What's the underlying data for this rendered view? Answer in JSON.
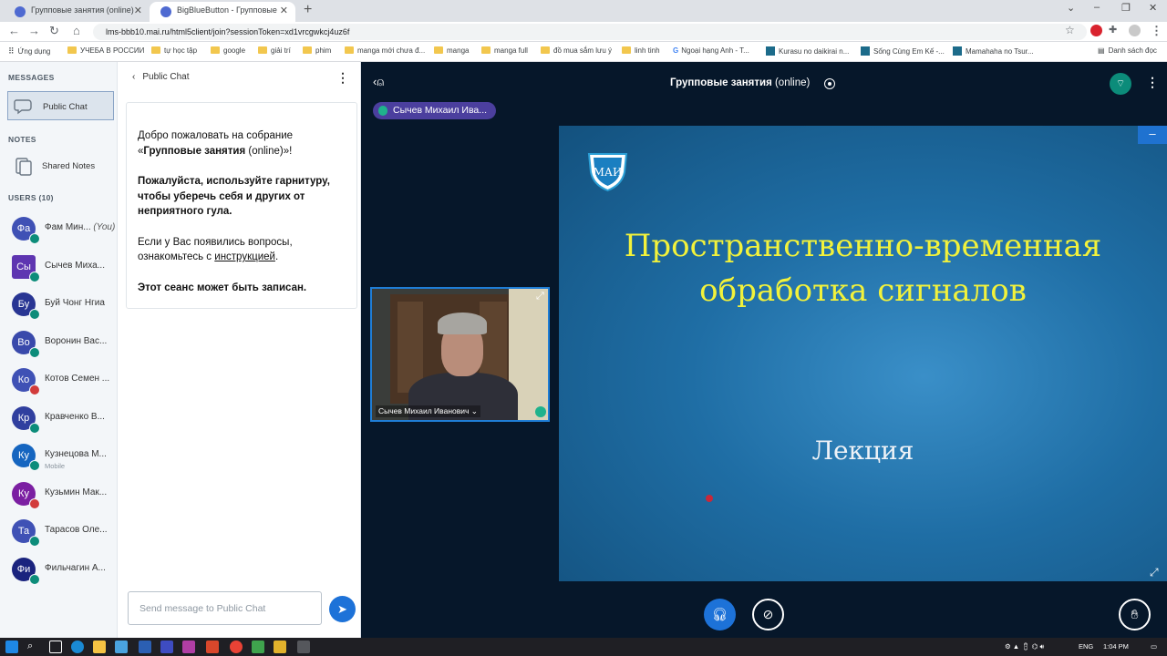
{
  "browser": {
    "tabs": [
      {
        "title": "Групповые занятия (online)",
        "active": false
      },
      {
        "title": "BigBlueButton - Групповые",
        "active": true
      }
    ],
    "url": "lms-bbb10.mai.ru/html5client/join?sessionToken=xd1vrcgwkcj4uz6f",
    "bookmarks": [
      {
        "label": "Ứng dụng",
        "kind": "apps"
      },
      {
        "label": "УЧЕБА В РОССИИ",
        "kind": "folder"
      },
      {
        "label": "tự học tập",
        "kind": "folder"
      },
      {
        "label": "google",
        "kind": "folder"
      },
      {
        "label": "giải trí",
        "kind": "folder"
      },
      {
        "label": "phim",
        "kind": "folder"
      },
      {
        "label": "manga mới chưa đ...",
        "kind": "folder"
      },
      {
        "label": "manga",
        "kind": "folder"
      },
      {
        "label": "manga full",
        "kind": "folder"
      },
      {
        "label": "đồ mua sắm lưu ý",
        "kind": "folder"
      },
      {
        "label": "linh tinh",
        "kind": "folder"
      },
      {
        "label": "Ngoại hạng Anh - T...",
        "kind": "site"
      },
      {
        "label": "Kurasu no daikirai n...",
        "kind": "site"
      },
      {
        "label": "Sống Cùng Em Kế -...",
        "kind": "site"
      },
      {
        "label": "Mamahaha no Tsur...",
        "kind": "site"
      },
      {
        "label": "Danh sách đọc",
        "kind": "reading-list"
      }
    ]
  },
  "sidebar": {
    "messages_title": "MESSAGES",
    "public_chat": "Public Chat",
    "notes_title": "NOTES",
    "shared_notes": "Shared Notes",
    "users_title": "USERS (10)",
    "users": [
      {
        "initials": "Фа",
        "name": "Фам Мин...",
        "suffix": "(You)",
        "color": "#3f51b5",
        "badge": "g",
        "square": false,
        "sub": ""
      },
      {
        "initials": "Сы",
        "name": "Сычев Миха...",
        "suffix": "",
        "color": "#5e35b1",
        "badge": "g",
        "square": true,
        "sub": ""
      },
      {
        "initials": "Бу",
        "name": "Буй Чонг Нгиа",
        "suffix": "",
        "color": "#283593",
        "badge": "g",
        "square": false,
        "sub": ""
      },
      {
        "initials": "Во",
        "name": "Воронин Вас...",
        "suffix": "",
        "color": "#3949ab",
        "badge": "g",
        "square": false,
        "sub": ""
      },
      {
        "initials": "Ко",
        "name": "Котов Семен ...",
        "suffix": "",
        "color": "#3f51b5",
        "badge": "r",
        "square": false,
        "sub": ""
      },
      {
        "initials": "Кр",
        "name": "Кравченко В...",
        "suffix": "",
        "color": "#303f9f",
        "badge": "g",
        "square": false,
        "sub": ""
      },
      {
        "initials": "Ку",
        "name": "Кузнецова М...",
        "suffix": "",
        "color": "#1565c0",
        "badge": "g",
        "square": false,
        "sub": "Mobile"
      },
      {
        "initials": "Ку",
        "name": "Кузьмин Мак...",
        "suffix": "",
        "color": "#7b1fa2",
        "badge": "r",
        "square": false,
        "sub": ""
      },
      {
        "initials": "Та",
        "name": "Тарасов Оле...",
        "suffix": "",
        "color": "#3f51b5",
        "badge": "g",
        "square": false,
        "sub": ""
      },
      {
        "initials": "Фи",
        "name": "Фильчагин А...",
        "suffix": "",
        "color": "#1a237e",
        "badge": "g",
        "square": false,
        "sub": ""
      }
    ]
  },
  "chat": {
    "title": "Public Chat",
    "welcome_1a": "Добро пожаловать на собрание «",
    "welcome_1b": "Групповые занятия",
    "welcome_1c": " (online)»!",
    "welcome_2": "Пожалуйста, используйте гарнитуру, чтобы уберечь себя и других от неприятного гула.",
    "welcome_3a": "Если у Вас появились вопросы, ознакомьтесь с ",
    "welcome_3b": "инструкцией",
    "welcome_3c": ".",
    "welcome_4": "Этот сеанс может быть записан.",
    "input_placeholder": "Send message to Public Chat"
  },
  "meeting": {
    "title": "Групповые занятия",
    "title_suffix": " (online)",
    "talker": "Сычев Михаил Ива...",
    "webcam_name": "Сычев Михаил Иванович"
  },
  "slide": {
    "logo_text": "МАИ",
    "title_line1": "Пространственно-временная",
    "title_line2": "обработка сигналов",
    "subtitle": "Лекция"
  },
  "taskbar": {
    "lang": "ENG",
    "time": "1:04 PM"
  },
  "colors": {
    "accent_blue": "#1d72d8",
    "talker_purple": "#4b3f9e",
    "slide_title_yellow": "#f2f23b",
    "status_green": "#0c8c7a"
  }
}
